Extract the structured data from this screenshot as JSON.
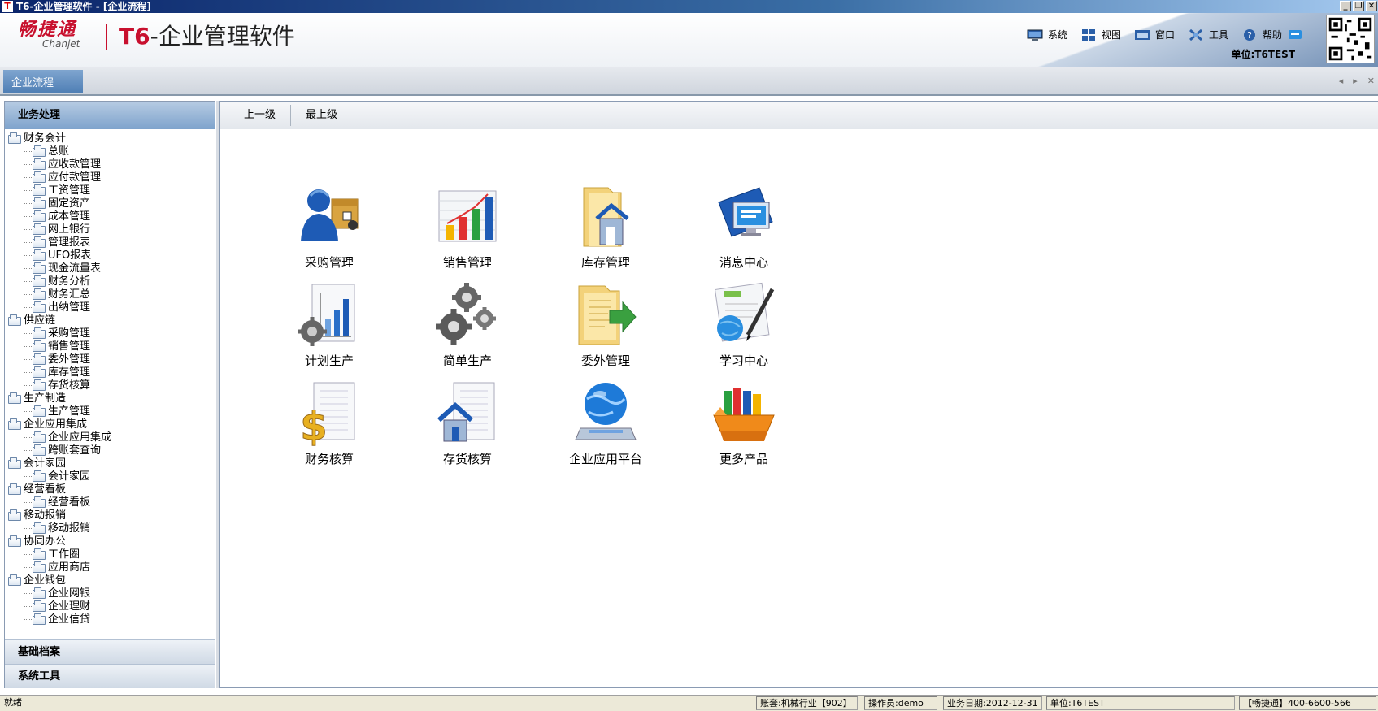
{
  "window": {
    "title": "T6-企业管理软件 - [企业流程]",
    "logo_letter": "T"
  },
  "brand": {
    "name_cn": "畅捷通",
    "name_en": "Chanjet",
    "product_prefix": "T6",
    "product_name": "-企业管理软件"
  },
  "menu": [
    {
      "label": "系统",
      "icon": "system-icon"
    },
    {
      "label": "视图",
      "icon": "view-icon"
    },
    {
      "label": "窗口",
      "icon": "window-icon"
    },
    {
      "label": "工具",
      "icon": "tools-icon"
    },
    {
      "label": "帮助",
      "icon": "help-icon"
    }
  ],
  "unit": "单位:T6TEST",
  "tab": {
    "label": "企业流程"
  },
  "sidebar": {
    "header": "业务处理",
    "tree": [
      {
        "label": "财务会计",
        "children": [
          "总账",
          "应收款管理",
          "应付款管理",
          "工资管理",
          "固定资产",
          "成本管理",
          "网上银行",
          "管理报表",
          "UFO报表",
          "现金流量表",
          "财务分析",
          "财务汇总",
          "出纳管理"
        ]
      },
      {
        "label": "供应链",
        "children": [
          "采购管理",
          "销售管理",
          "委外管理",
          "库存管理",
          "存货核算"
        ]
      },
      {
        "label": "生产制造",
        "children": [
          "生产管理"
        ]
      },
      {
        "label": "企业应用集成",
        "children": [
          "企业应用集成",
          "跨账套查询"
        ]
      },
      {
        "label": "会计家园",
        "children": [
          "会计家园"
        ]
      },
      {
        "label": "经营看板",
        "children": [
          "经营看板"
        ]
      },
      {
        "label": "移动报销",
        "children": [
          "移动报销"
        ]
      },
      {
        "label": "协同办公",
        "children": [
          "工作圈",
          "应用商店"
        ]
      },
      {
        "label": "企业钱包",
        "children": [
          "企业网银",
          "企业理财",
          "企业信贷"
        ]
      }
    ],
    "footer1": "基础档案",
    "footer2": "系统工具"
  },
  "toolbar": {
    "up_label": "上一级",
    "top_label": "最上级"
  },
  "tiles": [
    {
      "label": "采购管理",
      "icon": "purchase-icon"
    },
    {
      "label": "销售管理",
      "icon": "sales-chart-icon"
    },
    {
      "label": "库存管理",
      "icon": "warehouse-folder-icon"
    },
    {
      "label": "消息中心",
      "icon": "message-monitor-icon"
    },
    {
      "label": "计划生产",
      "icon": "plan-production-icon"
    },
    {
      "label": "简单生产",
      "icon": "gears-icon"
    },
    {
      "label": "委外管理",
      "icon": "outsource-folder-icon"
    },
    {
      "label": "学习中心",
      "icon": "learning-globe-icon"
    },
    {
      "label": "财务核算",
      "icon": "dollar-document-icon"
    },
    {
      "label": "存货核算",
      "icon": "inventory-house-icon"
    },
    {
      "label": "企业应用平台",
      "icon": "globe-platform-icon"
    },
    {
      "label": "更多产品",
      "icon": "product-box-icon"
    }
  ],
  "status": {
    "ready": "就绪",
    "account": "账套:机械行业【902】",
    "operator": "操作员:demo",
    "date": "业务日期:2012-12-31",
    "unit": "单位:T6TEST",
    "hotline": "【畅捷通】400-6600-566"
  }
}
